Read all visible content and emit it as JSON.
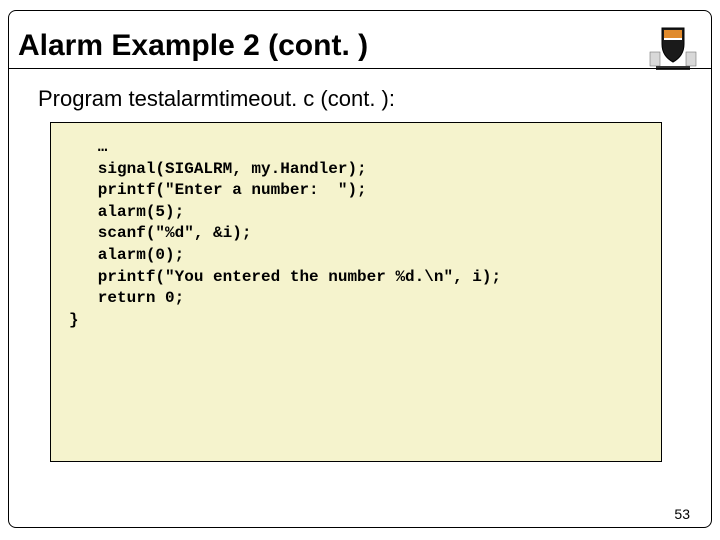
{
  "slide": {
    "title": "Alarm Example 2 (cont. )",
    "subtitle": "Program testalarmtimeout. c (cont. ):",
    "page_number": "53"
  },
  "code": {
    "l1": "   …",
    "l2": "   signal(SIGALRM, my.Handler);",
    "l3": "",
    "l4": "   printf(\"Enter a number:  \");",
    "l5": "   alarm(5);",
    "l6": "   scanf(\"%d\", &i);",
    "l7": "   alarm(0);",
    "l8": "",
    "l9": "   printf(\"You entered the number %d.\\n\", i);",
    "l10": "   return 0;",
    "l11": "}"
  },
  "logo": {
    "name": "princeton-crest"
  }
}
